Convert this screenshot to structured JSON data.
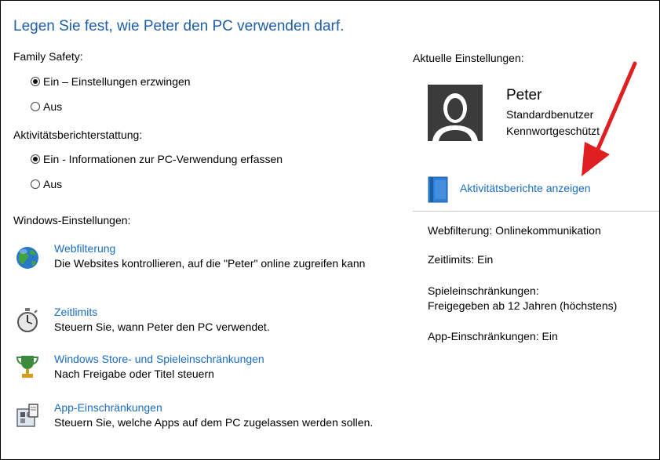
{
  "title": "Legen Sie fest, wie Peter den PC verwenden darf.",
  "family_safety": {
    "label": "Family Safety:",
    "options": [
      {
        "label": "Ein – Einstellungen erzwingen",
        "selected": true
      },
      {
        "label": "Aus",
        "selected": false
      }
    ]
  },
  "activity_reporting": {
    "label": "Aktivitätsberichterstattung:",
    "options": [
      {
        "label": "Ein - Informationen zur PC-Verwendung erfassen",
        "selected": true
      },
      {
        "label": "Aus",
        "selected": false
      }
    ]
  },
  "windows_settings": {
    "label": "Windows-Einstellungen:",
    "items": [
      {
        "icon": "globe-icon",
        "link": "Webfilterung",
        "description": "Die Websites kontrollieren, auf die \"Peter\" online zugreifen kann"
      },
      {
        "icon": "stopwatch-icon",
        "link": "Zeitlimits",
        "description": "Steuern Sie, wann Peter den PC verwendet."
      },
      {
        "icon": "trophy-icon",
        "link": "Windows Store- und Spieleinschränkungen",
        "description": "Nach Freigabe oder Titel steuern"
      },
      {
        "icon": "app-restriction-icon",
        "link": "App-Einschränkungen",
        "description": "Steuern Sie, welche Apps auf dem PC zugelassen werden sollen."
      }
    ]
  },
  "current_settings": {
    "label": "Aktuelle Einstellungen:",
    "user": {
      "name": "Peter",
      "account_type": "Standardbenutzer",
      "password_status": "Kennwortgeschützt"
    },
    "report_link": "Aktivitätsberichte anzeigen",
    "summary": {
      "web": "Webfilterung: Onlinekommunikation",
      "time": "Zeitlimits: Ein",
      "games_label": "Spieleinschränkungen:",
      "games_value": "Freigegeben ab 12 Jahren (höchstens)",
      "apps": "App-Einschränkungen: Ein"
    }
  },
  "colors": {
    "link": "#1a6cc0",
    "title": "#1f5fa8",
    "annotation_arrow": "#e02020"
  }
}
